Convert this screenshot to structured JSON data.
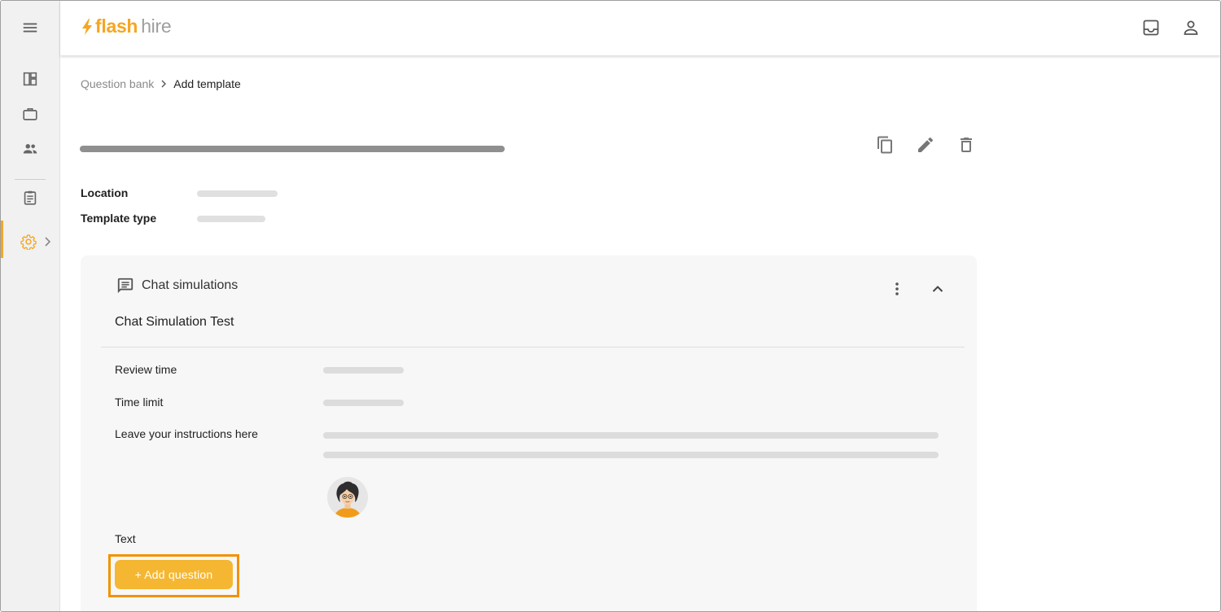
{
  "app": {
    "brand_flash": "flash",
    "brand_hire": "hire"
  },
  "breadcrumb": {
    "parent": "Question bank",
    "current": "Add template"
  },
  "template": {
    "location_label": "Location",
    "template_type_label": "Template type"
  },
  "section": {
    "header_title": "Chat simulations",
    "name": "Chat Simulation Test",
    "fields": {
      "review_time_label": "Review time",
      "time_limit_label": "Time limit",
      "instructions_label": "Leave your instructions here",
      "text_label": "Text"
    },
    "add_question_label": "+ Add question"
  },
  "colors": {
    "accent": "#f5a623",
    "button": "#f5b731",
    "highlight": "#f29200"
  },
  "icons": {
    "menu": "hamburger-menu-icon",
    "dashboard": "dashboard-icon",
    "jobs": "briefcase-icon",
    "people": "people-icon",
    "templates": "clipboard-icon",
    "settings": "gear-icon",
    "inbox": "inbox-icon",
    "account": "person-icon",
    "copy": "copy-icon",
    "edit": "pencil-icon",
    "delete": "trash-icon",
    "chat": "chat-icon",
    "more": "more-vertical-icon",
    "collapse": "chevron-up-icon"
  }
}
